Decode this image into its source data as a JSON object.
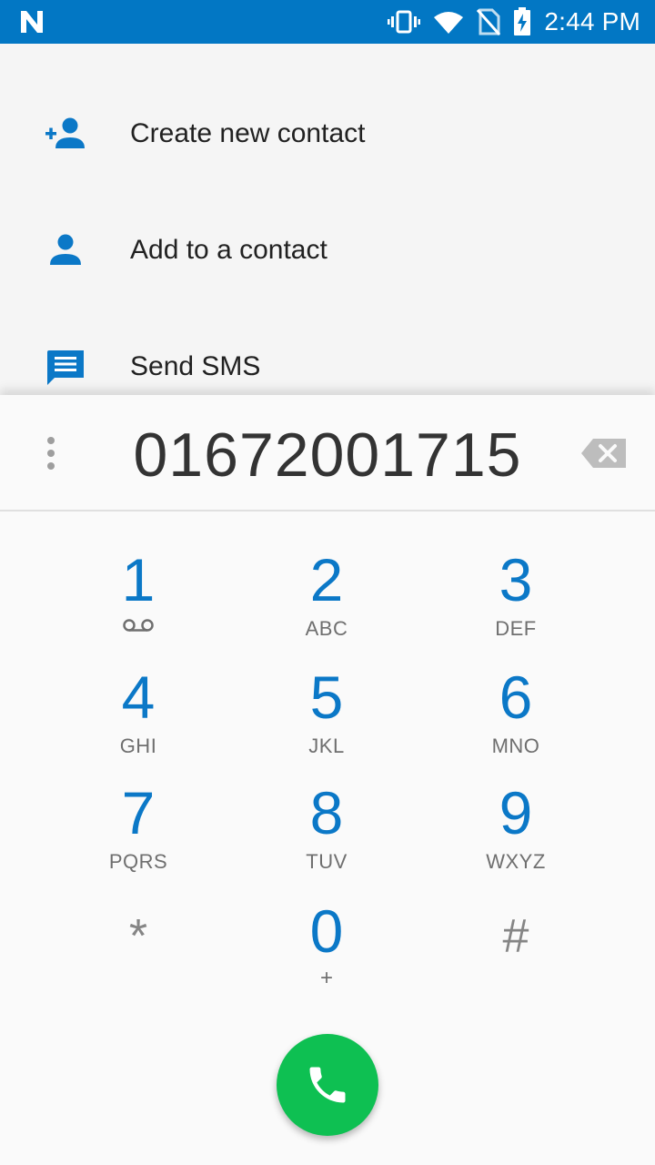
{
  "status_bar": {
    "time": "2:44 PM",
    "icons": [
      "n-notification-icon",
      "vibrate-icon",
      "wifi-icon",
      "no-sim-icon",
      "battery-charging-icon"
    ]
  },
  "actions": [
    {
      "label": "Create new contact",
      "icon": "person-add-icon"
    },
    {
      "label": "Add to a contact",
      "icon": "person-icon"
    },
    {
      "label": "Send SMS",
      "icon": "message-icon"
    }
  ],
  "dialer": {
    "number": "01672001715",
    "keys": [
      {
        "digit": "1",
        "letters": ""
      },
      {
        "digit": "2",
        "letters": "ABC"
      },
      {
        "digit": "3",
        "letters": "DEF"
      },
      {
        "digit": "4",
        "letters": "GHI"
      },
      {
        "digit": "5",
        "letters": "JKL"
      },
      {
        "digit": "6",
        "letters": "MNO"
      },
      {
        "digit": "7",
        "letters": "PQRS"
      },
      {
        "digit": "8",
        "letters": "TUV"
      },
      {
        "digit": "9",
        "letters": "WXYZ"
      },
      {
        "digit": "*",
        "letters": ""
      },
      {
        "digit": "0",
        "letters": "+"
      },
      {
        "digit": "#",
        "letters": ""
      }
    ]
  },
  "colors": {
    "status_bar": "#0277c4",
    "accent": "#0b78c7",
    "call_button": "#0ec052"
  }
}
